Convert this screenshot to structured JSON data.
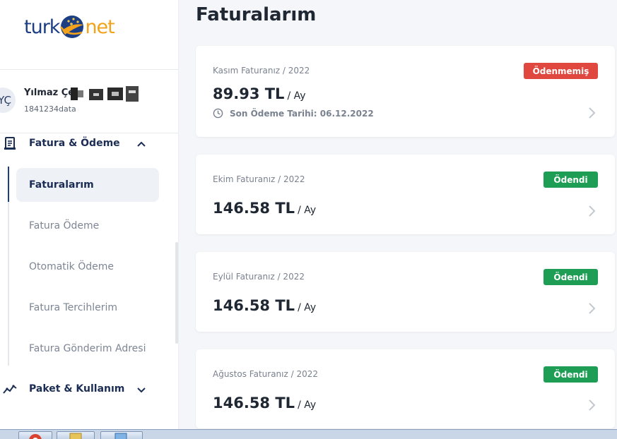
{
  "brand": {
    "part1": "turk",
    "part2": "net"
  },
  "user": {
    "name": "Yılmaz Çe",
    "code": "1841234data",
    "avatar_initials": "YÇ"
  },
  "menu": {
    "billing": {
      "label": "Fatura & Ödeme",
      "items": [
        {
          "label": "Faturalarım",
          "active": true
        },
        {
          "label": "Fatura Ödeme"
        },
        {
          "label": "Otomatik Ödeme"
        },
        {
          "label": "Fatura Tercihlerim"
        },
        {
          "label": "Fatura Gönderim Adresi"
        }
      ]
    },
    "package": {
      "label": "Paket & Kullanım"
    }
  },
  "page": {
    "title": "Faturalarım"
  },
  "invoices": [
    {
      "label": "Kasım Faturanız / 2022",
      "amount": "89.93 TL",
      "period": "/ Ay",
      "status": "Ödenmemiş",
      "due": "Son Ödeme Tarihi: 06.12.2022"
    },
    {
      "label": "Ekim Faturanız / 2022",
      "amount": "146.58 TL",
      "period": "/ Ay",
      "status": "Ödendi"
    },
    {
      "label": "Eylül Faturanız / 2022",
      "amount": "146.58 TL",
      "period": "/ Ay",
      "status": "Ödendi"
    },
    {
      "label": "Ağustos Faturanız / 2022",
      "amount": "146.58 TL",
      "period": "/ Ay",
      "status": "Ödendi"
    }
  ],
  "colors": {
    "brand_blue": "#1c3f84",
    "brand_orange": "#f2a21b",
    "unpaid": "#e0473e",
    "paid": "#1e9e55"
  }
}
